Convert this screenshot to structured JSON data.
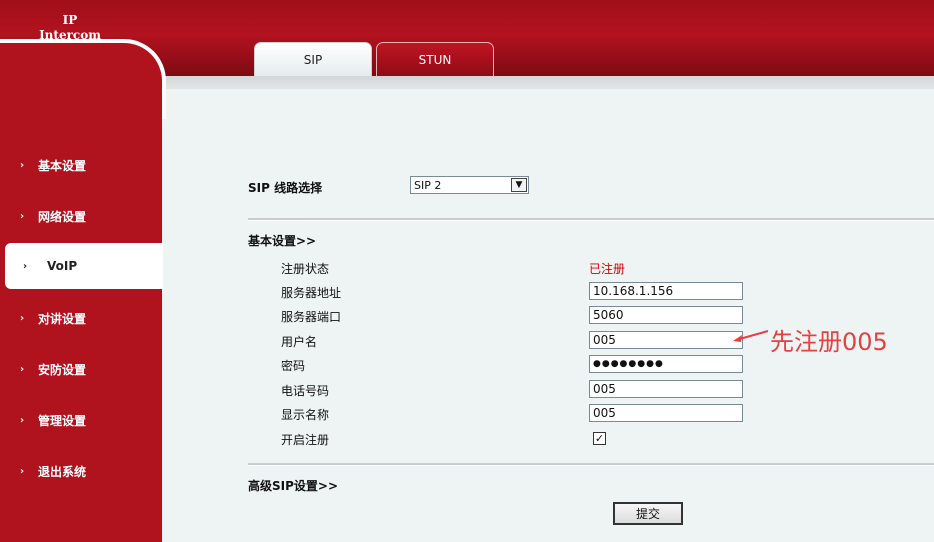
{
  "header": {
    "logo_line1": "IP",
    "logo_line2": "Intercom"
  },
  "sidebar": {
    "items": [
      {
        "label": "基本设置",
        "active": false
      },
      {
        "label": "网络设置",
        "active": false
      },
      {
        "label": "VoIP",
        "active": true
      },
      {
        "label": "对讲设置",
        "active": false
      },
      {
        "label": "安防设置",
        "active": false
      },
      {
        "label": "管理设置",
        "active": false
      },
      {
        "label": "退出系统",
        "active": false
      }
    ],
    "chevron": "›"
  },
  "tabs": [
    {
      "label": "SIP",
      "active": true
    },
    {
      "label": "STUN",
      "active": false
    }
  ],
  "line_select": {
    "label": "SIP 线路选择",
    "value": "SIP 2"
  },
  "basic": {
    "heading": "基本设置>>",
    "status_label": "注册状态",
    "status_value": "已注册",
    "server_addr_label": "服务器地址",
    "server_addr_value": "10.168.1.156",
    "server_port_label": "服务器端口",
    "server_port_value": "5060",
    "username_label": "用户名",
    "username_value": "005",
    "password_label": "密码",
    "password_value": "●●●●●●●●",
    "phone_label": "电话号码",
    "phone_value": "005",
    "display_name_label": "显示名称",
    "display_name_value": "005",
    "enable_label": "开启注册",
    "enable_checked": true
  },
  "advanced": {
    "heading": "高级SIP设置>>"
  },
  "submit_label": "提交",
  "annotation": {
    "text": "先注册005",
    "color": "#e83f3f"
  },
  "colors": {
    "brand_red": "#b0121e",
    "status_red": "#d40000"
  }
}
